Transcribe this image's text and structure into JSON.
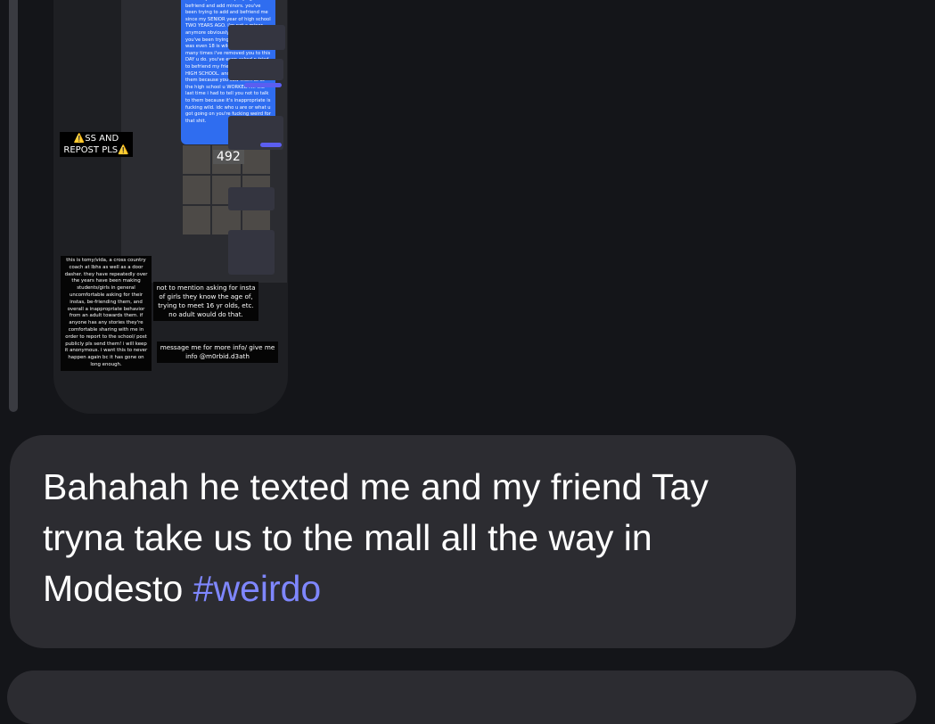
{
  "story": {
    "message_body": "dude why tf do u keep trying to befriend and add minors. you've been trying to add and befriend me since my SENIOR year of high school TWO YEARS AGO. i'm not a minor anymore obviously but the fact you've been trying to since before i was even 18 is wild. no matter how many times i've removed you to this DAY u do. you've even asked n tried to befriend my friend who's STILL IN HIGH SCHOOL. and said you knew them because you saw them at at the high school u WORKED AT. the last time i had to tell you not to talk to them because it's inappropriate is fucking wild. idc who u are or what u got going on you're fucking weird for that shit.",
    "count_badge": "492",
    "warning_label": "⚠️SS AND REPOST PLS⚠️",
    "left_caption": "this is tomy/vida, a cross country coach at lbhs as well as a door dasher. they have repeatedly over the years have been making students/girls in general uncomfortable asking for their instas, be-friending them, and overall a inappropriate behavior from an adult towards them. if anyone has any stories they're comfortable sharing with me in order to report to the school/ post publicly pls send them! i will keep it anonymous. i want this to never happen again bc it has gone on long enough.",
    "middle_caption": "not to mention asking for insta of girls they know the age of, trying to meet 16 yr olds, etc. no adult would do that.",
    "contact_caption": "message me for more info/ give me info @m0rbid.d3ath"
  },
  "message": {
    "text": "Bahahah he texted me and my friend Tay tryna take us to the mall all the way in Modesto ",
    "hashtag": "#weirdo"
  },
  "colors": {
    "background": "#141519",
    "bubble": "#2c2c31",
    "hashtag": "#7f87ff",
    "story_message": "#2f6df0"
  }
}
